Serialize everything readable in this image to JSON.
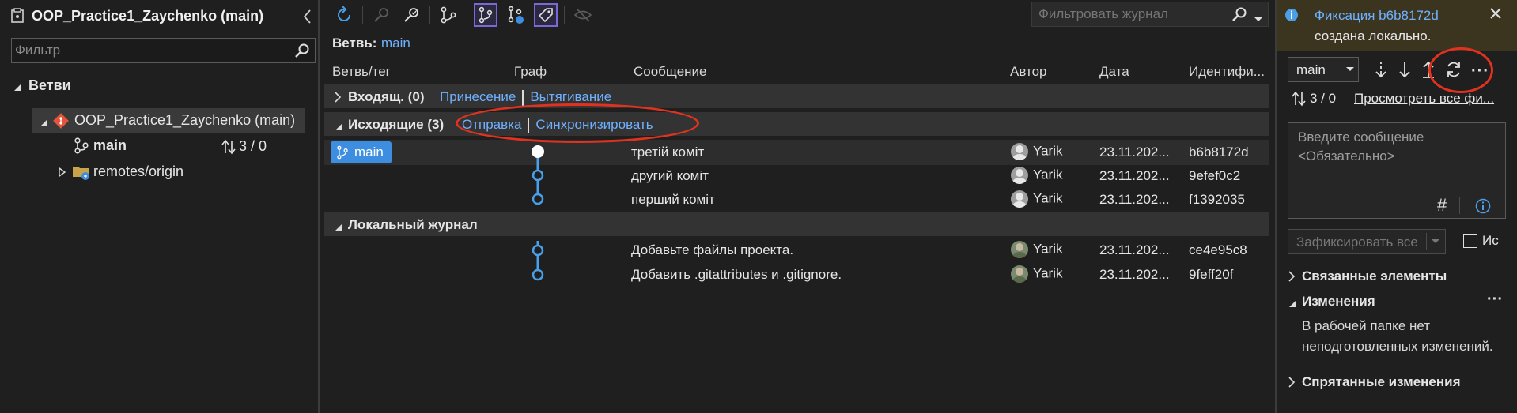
{
  "left": {
    "title": "OOP_Practice1_Zaychenko (main)",
    "filter_placeholder": "Фильтр",
    "section": "Ветви",
    "repo": "OOP_Practice1_Zaychenko (main)",
    "branch": "main",
    "branch_counts": "3 / 0",
    "remotes": "remotes/origin"
  },
  "center": {
    "filter_placeholder": "Фильтровать журнал",
    "branch_label": "Ветвь:",
    "branch_value": "main",
    "columns": {
      "branch": "Ветвь/тег",
      "graph": "Граф",
      "message": "Сообщение",
      "author": "Автор",
      "date": "Дата",
      "id": "Идентифи..."
    },
    "incoming": {
      "label": "Входящ. (0)",
      "fetch": "Принесение",
      "pull": "Вытягивание"
    },
    "outgoing": {
      "label": "Исходящие (3)",
      "push": "Отправка",
      "sync": "Синхронизировать",
      "branch_tag": "main",
      "commits": [
        {
          "message": "третій коміт",
          "author": "Yarik",
          "date": "23.11.202...",
          "id": "b6b8172d"
        },
        {
          "message": "другий коміт",
          "author": "Yarik",
          "date": "23.11.202...",
          "id": "9efef0c2"
        },
        {
          "message": "перший коміт",
          "author": "Yarik",
          "date": "23.11.202...",
          "id": "f1392035"
        }
      ]
    },
    "local": {
      "label": "Локальный журнал",
      "commits": [
        {
          "message": "Добавьте файлы проекта.",
          "author": "Yarik",
          "date": "23.11.202...",
          "id": "ce4e95c8"
        },
        {
          "message": "Добавить .gitattributes и .gitignore.",
          "author": "Yarik",
          "date": "23.11.202...",
          "id": "9feff20f"
        }
      ]
    }
  },
  "right": {
    "notify_title": "Фиксация b6b8172d",
    "notify_sub": "создана локально.",
    "branch": "main",
    "counts": "3 / 0",
    "view_all": "Просмотреть все фи...",
    "msg_placeholder": "Введите сообщение <Обязательно>",
    "commit_all": "Зафиксировать все",
    "amend_label": "Ис",
    "linked": "Связанные элементы",
    "changes": "Изменения",
    "changes_text": "В рабочей папке нет неподготовленных изменений.",
    "stashes": "Спрятанные изменения"
  },
  "colors": {
    "accent": "#6fb1ff",
    "graph": "#4a9fe8",
    "annotation": "#e0321e",
    "active_toggle": "#7b67d6",
    "branch_tag_bg": "#3d8ee0",
    "info_bar": "#3b3520"
  }
}
